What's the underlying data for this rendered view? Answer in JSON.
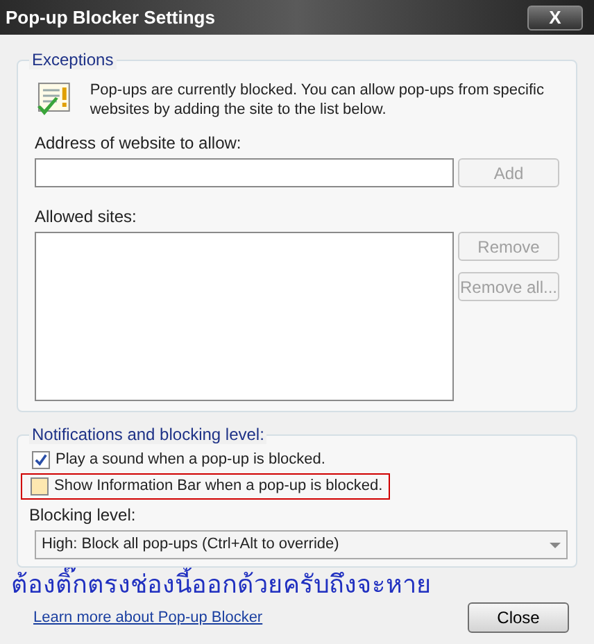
{
  "window": {
    "title": "Pop-up Blocker Settings",
    "close_label": "X"
  },
  "exceptions": {
    "legend": "Exceptions",
    "info": "Pop-ups are currently blocked.  You can allow pop-ups from specific websites by adding the site to the list below.",
    "address_label": "Address of website to allow:",
    "add_button": {
      "label": "Add",
      "disabled": true
    },
    "allowed_label": "Allowed sites:",
    "side_buttons": [
      {
        "label": "Remove",
        "disabled": true
      },
      {
        "label": "Remove all...",
        "disabled": true
      }
    ]
  },
  "notifications": {
    "legend": "Notifications and blocking level:",
    "options": [
      {
        "label": "Play a sound when a pop-up is blocked.",
        "checked": true,
        "highlighted": false
      },
      {
        "label": "Show Information Bar when a pop-up is blocked.",
        "checked": false,
        "highlighted": true
      }
    ],
    "level_label": "Blocking level:",
    "level_value": "High: Block all pop-ups (Ctrl+Alt to override)"
  },
  "annotation": "ต้องติ๊กตรงช่องนี้ออกด้วยครับถึงจะหาย",
  "learn_more_link": "Learn more about Pop-up Blocker",
  "close_button": {
    "label": "Close",
    "disabled": false
  }
}
